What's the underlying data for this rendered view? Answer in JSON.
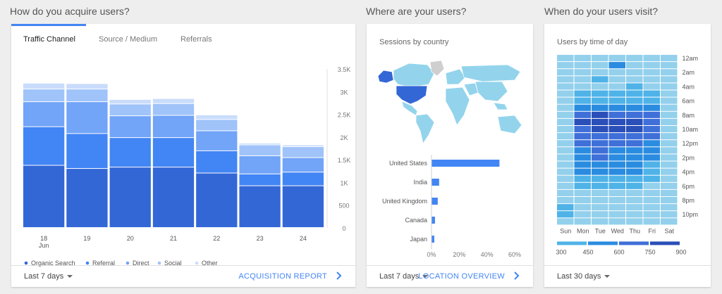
{
  "sections": {
    "acquire": "How do you acquire users?",
    "where": "Where are your users?",
    "when": "When do your users visit?"
  },
  "acquisition": {
    "tabs": [
      "Traffic Channel",
      "Source / Medium",
      "Referrals"
    ],
    "active_tab": 0,
    "footer": {
      "date_range": "Last 7 days",
      "link": "ACQUISITION REPORT"
    }
  },
  "location": {
    "subtitle": "Sessions by country",
    "footer": {
      "date_range": "Last 7 days",
      "link": "LOCATION OVERVIEW"
    }
  },
  "time": {
    "subtitle": "Users by time of day",
    "footer": {
      "date_range": "Last 30 days"
    }
  },
  "colors": {
    "organic": "#3367d6",
    "referral": "#4285f4",
    "direct": "#72a4f7",
    "social": "#a0c3f9",
    "other": "#c9dcfb",
    "accent": "#4285f4",
    "heat": [
      "#93d0ec",
      "#4fb3e8",
      "#2a8ce0",
      "#3f6fd8",
      "#2a4fb8"
    ]
  },
  "chart_data": [
    {
      "type": "bar",
      "stacked": true,
      "title": "",
      "categories": [
        "18",
        "19",
        "20",
        "21",
        "22",
        "23",
        "24"
      ],
      "category_sublabels": [
        "Jun",
        "",
        "",
        "",
        "",
        "",
        ""
      ],
      "series": [
        {
          "name": "Organic Search",
          "values": [
            1370,
            1300,
            1330,
            1330,
            1200,
            920,
            920
          ]
        },
        {
          "name": "Referral",
          "values": [
            850,
            770,
            650,
            650,
            490,
            260,
            300
          ]
        },
        {
          "name": "Direct",
          "values": [
            550,
            700,
            480,
            490,
            440,
            400,
            320
          ]
        },
        {
          "name": "Social",
          "values": [
            280,
            280,
            260,
            260,
            250,
            240,
            240
          ]
        },
        {
          "name": "Other",
          "values": [
            130,
            120,
            100,
            110,
            100,
            40,
            40
          ]
        }
      ],
      "y_ticks": [
        "0",
        "500",
        "1K",
        "1.5K",
        "2K",
        "2.5K",
        "3K",
        "3.5K"
      ],
      "ylim": [
        0,
        3500
      ],
      "legend": "bottom"
    },
    {
      "type": "bar",
      "orientation": "horizontal",
      "categories": [
        "United States",
        "India",
        "United Kingdom",
        "Canada",
        "Japan"
      ],
      "values": [
        49,
        5.5,
        4.5,
        2.5,
        2
      ],
      "x_ticks": [
        "0%",
        "20%",
        "40%",
        "60%"
      ],
      "xlim": [
        0,
        60
      ]
    },
    {
      "type": "heatmap",
      "x_labels": [
        "Sun",
        "Mon",
        "Tue",
        "Wed",
        "Thu",
        "Fri",
        "Sat"
      ],
      "y_labels": [
        "12am",
        "2am",
        "4am",
        "6am",
        "8am",
        "10am",
        "12pm",
        "2pm",
        "4pm",
        "6pm",
        "8pm",
        "10pm"
      ],
      "legend_ticks": [
        "300",
        "450",
        "600",
        "750",
        "900"
      ],
      "values": [
        [
          330,
          340,
          330,
          360,
          330,
          340,
          330
        ],
        [
          320,
          330,
          330,
          690,
          330,
          330,
          320
        ],
        [
          320,
          320,
          320,
          320,
          320,
          320,
          320
        ],
        [
          320,
          330,
          470,
          330,
          340,
          330,
          320
        ],
        [
          320,
          350,
          360,
          340,
          470,
          330,
          320
        ],
        [
          330,
          480,
          480,
          490,
          490,
          480,
          330
        ],
        [
          340,
          560,
          570,
          570,
          560,
          560,
          340
        ],
        [
          350,
          650,
          700,
          690,
          660,
          650,
          350
        ],
        [
          370,
          760,
          860,
          820,
          800,
          760,
          360
        ],
        [
          380,
          850,
          900,
          880,
          870,
          820,
          370
        ],
        [
          390,
          840,
          880,
          860,
          850,
          790,
          380
        ],
        [
          390,
          800,
          840,
          800,
          790,
          760,
          380
        ],
        [
          380,
          760,
          810,
          780,
          760,
          700,
          370
        ],
        [
          380,
          720,
          760,
          740,
          720,
          660,
          360
        ],
        [
          370,
          680,
          760,
          700,
          690,
          620,
          360
        ],
        [
          370,
          650,
          690,
          660,
          650,
          560,
          360
        ],
        [
          370,
          600,
          640,
          620,
          600,
          520,
          360
        ],
        [
          370,
          540,
          580,
          560,
          540,
          470,
          350
        ],
        [
          360,
          470,
          500,
          490,
          470,
          420,
          350
        ],
        [
          360,
          400,
          420,
          410,
          400,
          380,
          350
        ],
        [
          400,
          380,
          390,
          390,
          380,
          360,
          350
        ],
        [
          560,
          370,
          370,
          370,
          360,
          350,
          340
        ],
        [
          560,
          360,
          360,
          360,
          350,
          340,
          340
        ],
        [
          340,
          340,
          340,
          340,
          340,
          330,
          330
        ]
      ]
    }
  ]
}
